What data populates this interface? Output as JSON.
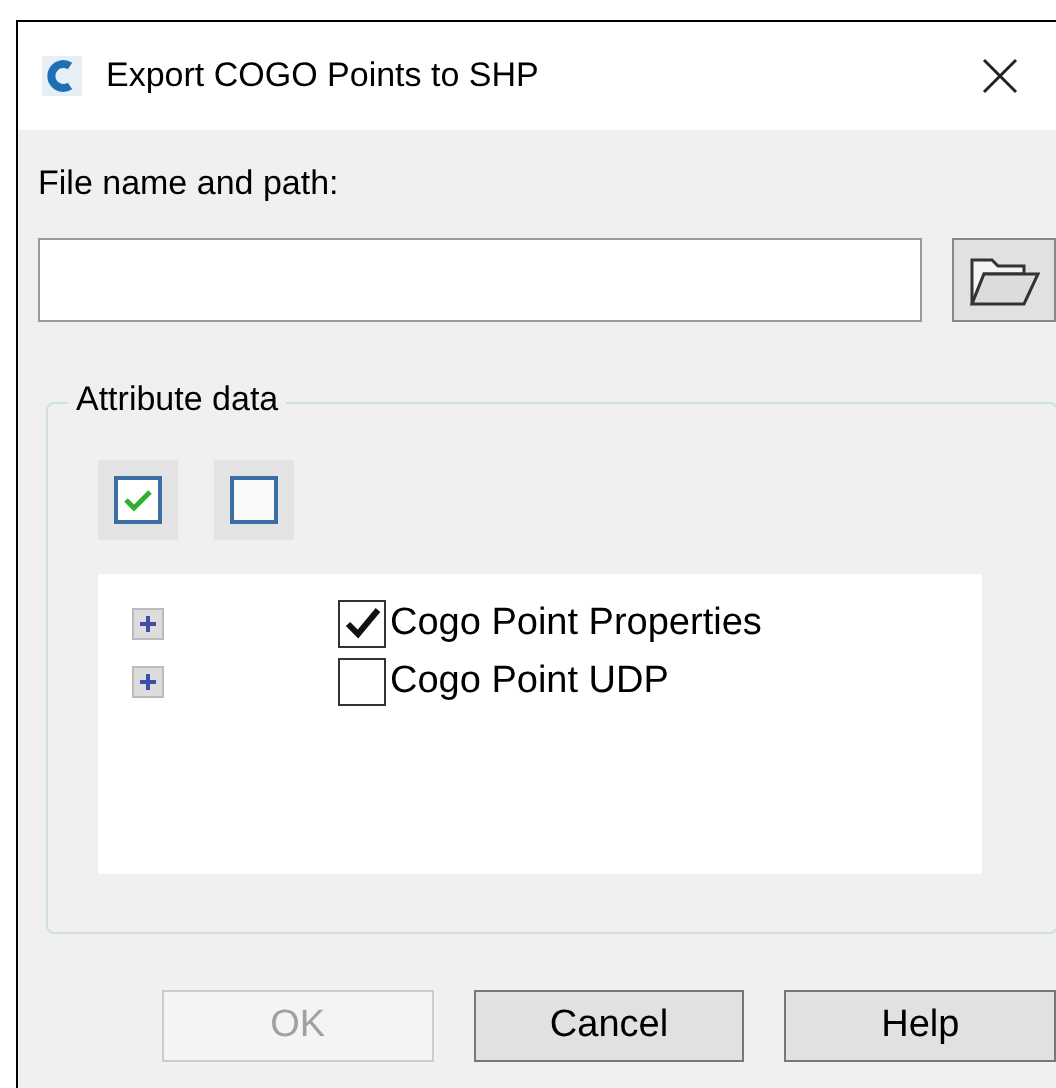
{
  "window": {
    "title": "Export COGO Points to SHP"
  },
  "file_field": {
    "label": "File name and path:"
  },
  "attribute_group": {
    "title": "Attribute data",
    "tree": [
      {
        "label": "Cogo Point Properties",
        "checked": true
      },
      {
        "label": "Cogo Point UDP",
        "checked": false
      }
    ]
  },
  "buttons": [
    {
      "label": "OK",
      "disabled": true
    },
    {
      "label": "Cancel",
      "disabled": false
    },
    {
      "label": "Help",
      "disabled": false
    }
  ]
}
